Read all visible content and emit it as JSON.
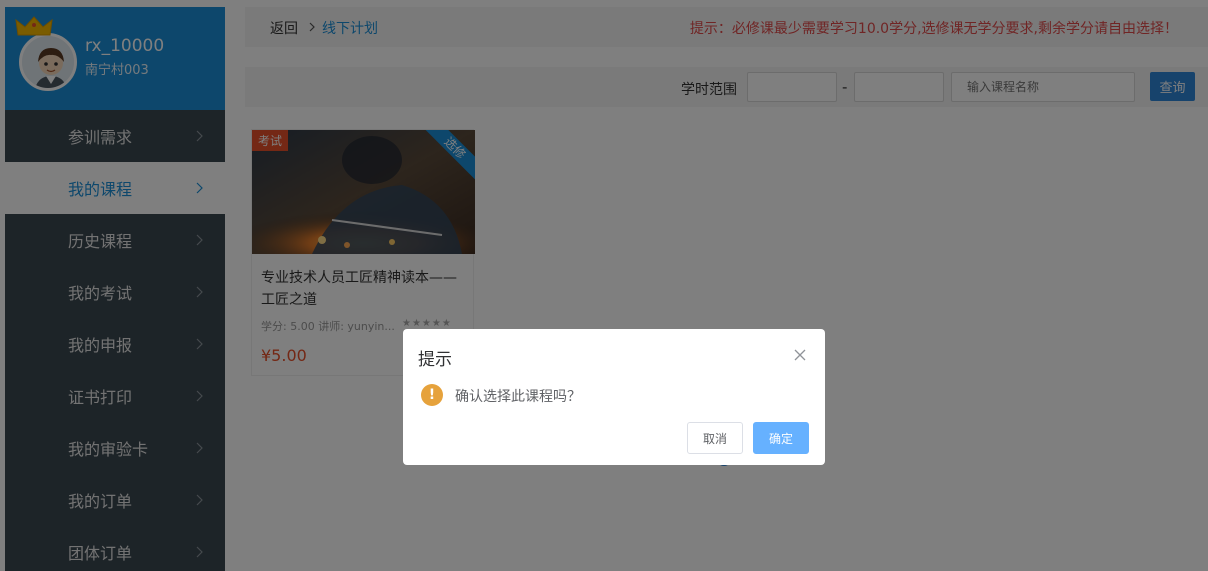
{
  "profile": {
    "username": "rx_10000",
    "subname": "南宁村003"
  },
  "sidebar": {
    "items": [
      {
        "label": "参训需求"
      },
      {
        "label": "我的课程"
      },
      {
        "label": "历史课程"
      },
      {
        "label": "我的考试"
      },
      {
        "label": "我的申报"
      },
      {
        "label": "证书打印"
      },
      {
        "label": "我的审验卡"
      },
      {
        "label": "我的订单"
      },
      {
        "label": "团体订单"
      }
    ],
    "active_index": 1
  },
  "breadcrumb": {
    "back": "返回",
    "current": "线下计划"
  },
  "tip": "提示：必修课最少需要学习10.0学分,选修课无学分要求,剩余学分请自由选择！",
  "filter": {
    "range_label": "学时范围",
    "dash": "-",
    "search_placeholder": "输入课程名称",
    "search_button": "查询"
  },
  "course": {
    "tag": "考试",
    "ribbon": "选修",
    "title": "专业技术人员工匠精神读本——工匠之道",
    "meta": "学分: 5.00 讲师: yunyin...",
    "stars": "★★★★★",
    "price": "¥5.00"
  },
  "modal": {
    "title": "提示",
    "message": "确认选择此课程吗？",
    "warn_symbol": "!",
    "cancel": "取消",
    "confirm": "确定"
  },
  "colors": {
    "sidebar_bg": "#3b4850",
    "profile_bg": "#1a8fd8",
    "accent": "#1a8fd8",
    "tip_red": "#e04b4b",
    "price_orange": "#e8502a",
    "confirm_btn": "#66b1ff",
    "warning": "#e6a23c"
  }
}
